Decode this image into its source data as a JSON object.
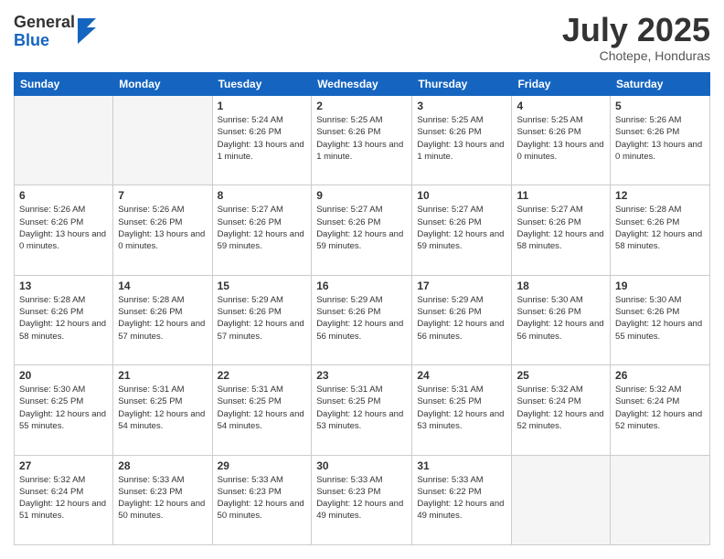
{
  "header": {
    "logo_general": "General",
    "logo_blue": "Blue",
    "month_title": "July 2025",
    "subtitle": "Chotepe, Honduras"
  },
  "days_of_week": [
    "Sunday",
    "Monday",
    "Tuesday",
    "Wednesday",
    "Thursday",
    "Friday",
    "Saturday"
  ],
  "weeks": [
    [
      {
        "day": "",
        "content": ""
      },
      {
        "day": "",
        "content": ""
      },
      {
        "day": "1",
        "content": "Sunrise: 5:24 AM\nSunset: 6:26 PM\nDaylight: 13 hours and 1 minute."
      },
      {
        "day": "2",
        "content": "Sunrise: 5:25 AM\nSunset: 6:26 PM\nDaylight: 13 hours and 1 minute."
      },
      {
        "day": "3",
        "content": "Sunrise: 5:25 AM\nSunset: 6:26 PM\nDaylight: 13 hours and 1 minute."
      },
      {
        "day": "4",
        "content": "Sunrise: 5:25 AM\nSunset: 6:26 PM\nDaylight: 13 hours and 0 minutes."
      },
      {
        "day": "5",
        "content": "Sunrise: 5:26 AM\nSunset: 6:26 PM\nDaylight: 13 hours and 0 minutes."
      }
    ],
    [
      {
        "day": "6",
        "content": "Sunrise: 5:26 AM\nSunset: 6:26 PM\nDaylight: 13 hours and 0 minutes."
      },
      {
        "day": "7",
        "content": "Sunrise: 5:26 AM\nSunset: 6:26 PM\nDaylight: 13 hours and 0 minutes."
      },
      {
        "day": "8",
        "content": "Sunrise: 5:27 AM\nSunset: 6:26 PM\nDaylight: 12 hours and 59 minutes."
      },
      {
        "day": "9",
        "content": "Sunrise: 5:27 AM\nSunset: 6:26 PM\nDaylight: 12 hours and 59 minutes."
      },
      {
        "day": "10",
        "content": "Sunrise: 5:27 AM\nSunset: 6:26 PM\nDaylight: 12 hours and 59 minutes."
      },
      {
        "day": "11",
        "content": "Sunrise: 5:27 AM\nSunset: 6:26 PM\nDaylight: 12 hours and 58 minutes."
      },
      {
        "day": "12",
        "content": "Sunrise: 5:28 AM\nSunset: 6:26 PM\nDaylight: 12 hours and 58 minutes."
      }
    ],
    [
      {
        "day": "13",
        "content": "Sunrise: 5:28 AM\nSunset: 6:26 PM\nDaylight: 12 hours and 58 minutes."
      },
      {
        "day": "14",
        "content": "Sunrise: 5:28 AM\nSunset: 6:26 PM\nDaylight: 12 hours and 57 minutes."
      },
      {
        "day": "15",
        "content": "Sunrise: 5:29 AM\nSunset: 6:26 PM\nDaylight: 12 hours and 57 minutes."
      },
      {
        "day": "16",
        "content": "Sunrise: 5:29 AM\nSunset: 6:26 PM\nDaylight: 12 hours and 56 minutes."
      },
      {
        "day": "17",
        "content": "Sunrise: 5:29 AM\nSunset: 6:26 PM\nDaylight: 12 hours and 56 minutes."
      },
      {
        "day": "18",
        "content": "Sunrise: 5:30 AM\nSunset: 6:26 PM\nDaylight: 12 hours and 56 minutes."
      },
      {
        "day": "19",
        "content": "Sunrise: 5:30 AM\nSunset: 6:26 PM\nDaylight: 12 hours and 55 minutes."
      }
    ],
    [
      {
        "day": "20",
        "content": "Sunrise: 5:30 AM\nSunset: 6:25 PM\nDaylight: 12 hours and 55 minutes."
      },
      {
        "day": "21",
        "content": "Sunrise: 5:31 AM\nSunset: 6:25 PM\nDaylight: 12 hours and 54 minutes."
      },
      {
        "day": "22",
        "content": "Sunrise: 5:31 AM\nSunset: 6:25 PM\nDaylight: 12 hours and 54 minutes."
      },
      {
        "day": "23",
        "content": "Sunrise: 5:31 AM\nSunset: 6:25 PM\nDaylight: 12 hours and 53 minutes."
      },
      {
        "day": "24",
        "content": "Sunrise: 5:31 AM\nSunset: 6:25 PM\nDaylight: 12 hours and 53 minutes."
      },
      {
        "day": "25",
        "content": "Sunrise: 5:32 AM\nSunset: 6:24 PM\nDaylight: 12 hours and 52 minutes."
      },
      {
        "day": "26",
        "content": "Sunrise: 5:32 AM\nSunset: 6:24 PM\nDaylight: 12 hours and 52 minutes."
      }
    ],
    [
      {
        "day": "27",
        "content": "Sunrise: 5:32 AM\nSunset: 6:24 PM\nDaylight: 12 hours and 51 minutes."
      },
      {
        "day": "28",
        "content": "Sunrise: 5:33 AM\nSunset: 6:23 PM\nDaylight: 12 hours and 50 minutes."
      },
      {
        "day": "29",
        "content": "Sunrise: 5:33 AM\nSunset: 6:23 PM\nDaylight: 12 hours and 50 minutes."
      },
      {
        "day": "30",
        "content": "Sunrise: 5:33 AM\nSunset: 6:23 PM\nDaylight: 12 hours and 49 minutes."
      },
      {
        "day": "31",
        "content": "Sunrise: 5:33 AM\nSunset: 6:22 PM\nDaylight: 12 hours and 49 minutes."
      },
      {
        "day": "",
        "content": ""
      },
      {
        "day": "",
        "content": ""
      }
    ]
  ]
}
